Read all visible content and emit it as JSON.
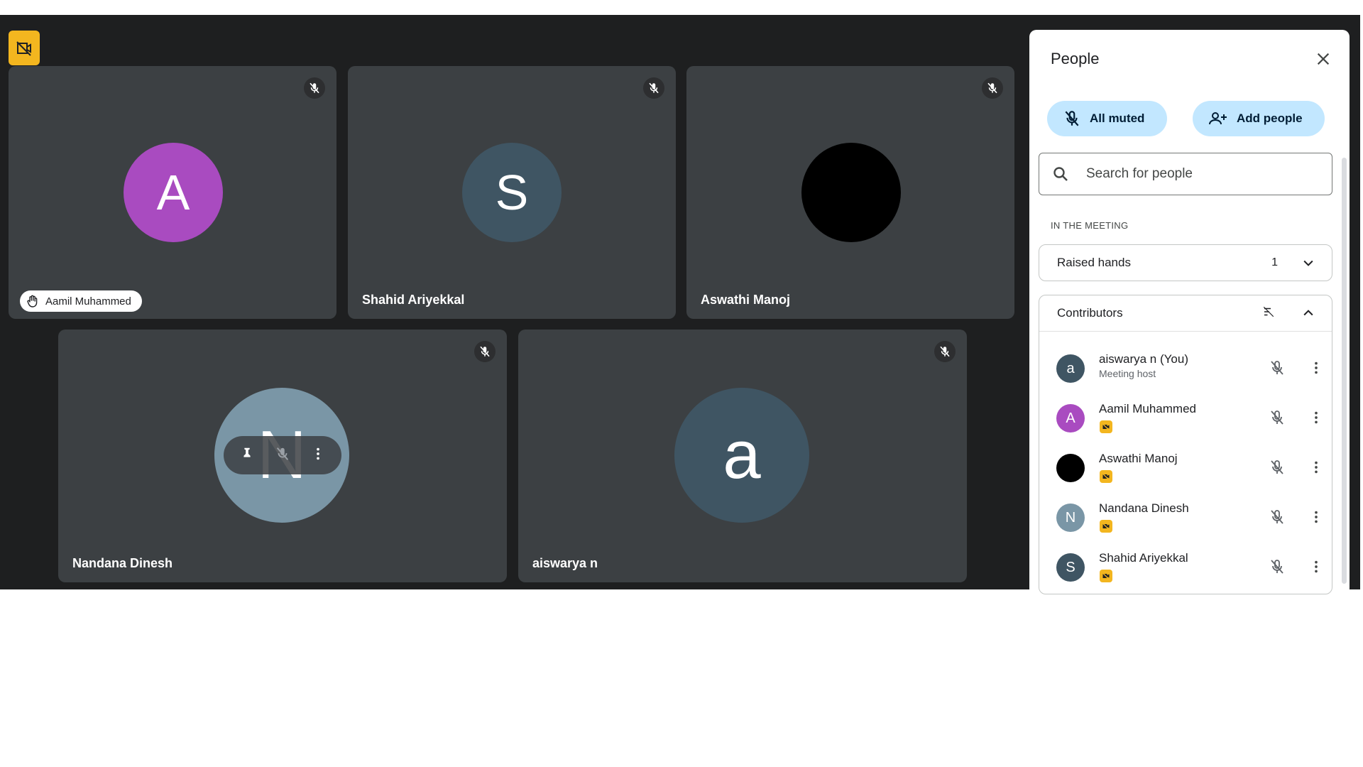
{
  "tiles": [
    {
      "name": "Aamil Muhammed",
      "initial": "A",
      "avatar_color": "#a94bc0",
      "hand_raised": true
    },
    {
      "name": "Shahid Ariyekkal",
      "initial": "S",
      "avatar_color": "#3f5563",
      "hand_raised": false
    },
    {
      "name": "Aswathi Manoj",
      "initial": "",
      "avatar_color": "#000000",
      "hand_raised": false
    },
    {
      "name": "Nandana Dinesh",
      "initial": "N",
      "avatar_color": "#7a96a6",
      "hand_raised": false
    },
    {
      "name": "aiswarya n",
      "initial": "a",
      "avatar_color": "#3f5563",
      "hand_raised": false
    }
  ],
  "panel": {
    "title": "People",
    "all_muted_label": "All muted",
    "add_people_label": "Add people",
    "search_placeholder": "Search for people",
    "section_label": "IN THE MEETING",
    "raised_hands": {
      "label": "Raised hands",
      "count": "1"
    },
    "contributors": {
      "label": "Contributors"
    },
    "people": [
      {
        "name": "aiswarya n (You)",
        "sub": "Meeting host",
        "initial": "a",
        "color": "#3f5563",
        "badge": false
      },
      {
        "name": "Aamil Muhammed",
        "sub": "",
        "initial": "A",
        "color": "#a94bc0",
        "badge": true
      },
      {
        "name": "Aswathi Manoj",
        "sub": "",
        "initial": "",
        "color": "#000000",
        "badge": true
      },
      {
        "name": "Nandana Dinesh",
        "sub": "",
        "initial": "N",
        "color": "#7a96a6",
        "badge": true
      },
      {
        "name": "Shahid Ariyekkal",
        "sub": "",
        "initial": "S",
        "color": "#3f5563",
        "badge": true
      }
    ]
  },
  "colors": {
    "stage_bg": "#1e1f20",
    "tile_bg": "#3c4043",
    "pill_bg": "#c2e7ff",
    "badge": "#f3b61f"
  }
}
